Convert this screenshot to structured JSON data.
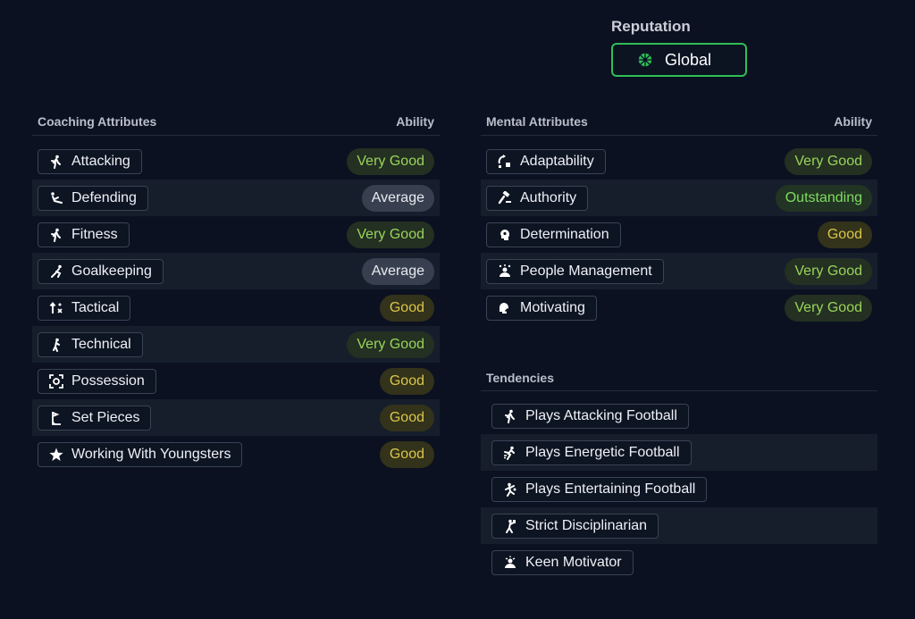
{
  "reputation": {
    "label": "Reputation",
    "value": "Global",
    "accent": "#2fbf57"
  },
  "coaching": {
    "header": "Coaching Attributes",
    "ability_header": "Ability",
    "items": [
      {
        "label": "Attacking",
        "ability": "Very Good",
        "icon": "runner-icon"
      },
      {
        "label": "Defending",
        "ability": "Average",
        "icon": "slide-tackle-icon"
      },
      {
        "label": "Fitness",
        "ability": "Very Good",
        "icon": "runner-icon"
      },
      {
        "label": "Goalkeeping",
        "ability": "Average",
        "icon": "goalkeeper-icon"
      },
      {
        "label": "Tactical",
        "ability": "Good",
        "icon": "tactics-icon"
      },
      {
        "label": "Technical",
        "ability": "Very Good",
        "icon": "dribble-icon"
      },
      {
        "label": "Possession",
        "ability": "Good",
        "icon": "possession-icon"
      },
      {
        "label": "Set Pieces",
        "ability": "Good",
        "icon": "corner-flag-icon"
      },
      {
        "label": "Working With Youngsters",
        "ability": "Good",
        "icon": "star-icon"
      }
    ]
  },
  "mental": {
    "header": "Mental Attributes",
    "ability_header": "Ability",
    "items": [
      {
        "label": "Adaptability",
        "ability": "Very Good",
        "icon": "adapt-icon"
      },
      {
        "label": "Authority",
        "ability": "Outstanding",
        "icon": "gavel-icon"
      },
      {
        "label": "Determination",
        "ability": "Good",
        "icon": "head-icon"
      },
      {
        "label": "People Management",
        "ability": "Very Good",
        "icon": "people-icon"
      },
      {
        "label": "Motivating",
        "ability": "Very Good",
        "icon": "motivate-icon"
      }
    ]
  },
  "tendencies": {
    "header": "Tendencies",
    "items": [
      {
        "label": "Plays Attacking Football",
        "icon": "runner-icon"
      },
      {
        "label": "Plays Energetic Football",
        "icon": "energetic-icon"
      },
      {
        "label": "Plays Entertaining Football",
        "icon": "entertain-icon"
      },
      {
        "label": "Strict Disciplinarian",
        "icon": "discipline-icon"
      },
      {
        "label": "Keen Motivator",
        "icon": "motivator-icon"
      }
    ]
  },
  "colors": {
    "very_good": "#9ad35a",
    "good": "#d9c64a",
    "average": "#e8eaef",
    "outstanding": "#7fdc5f"
  }
}
